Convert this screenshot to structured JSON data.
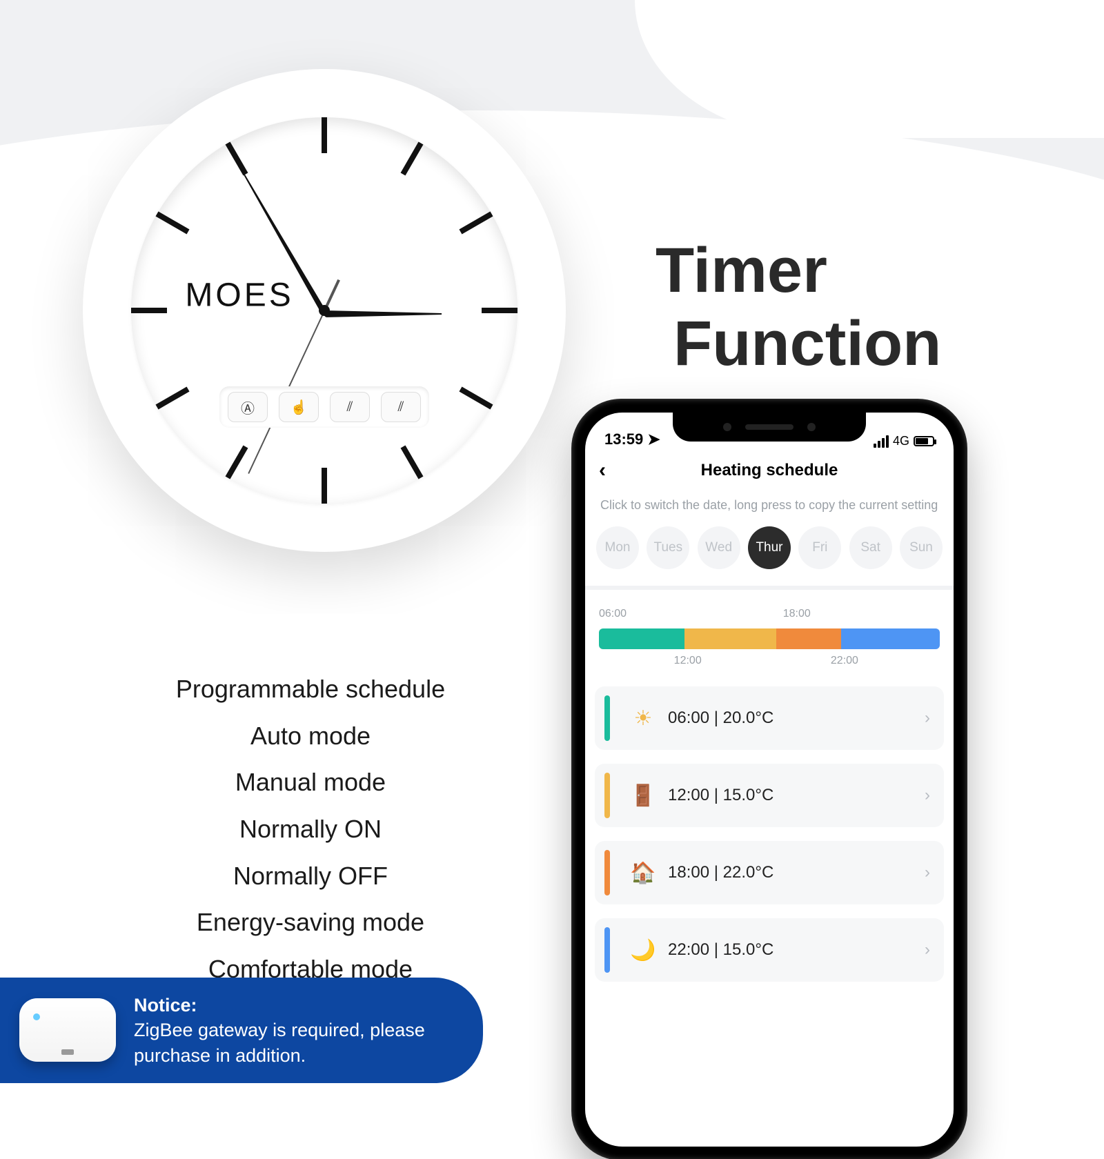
{
  "title_line1": "Timer",
  "title_line2": "Function",
  "clock_brand": "MOES",
  "features": [
    "Programmable schedule",
    "Auto mode",
    "Manual mode",
    "Normally ON",
    "Normally OFF",
    "Energy-saving mode",
    "Comfortable mode"
  ],
  "notice": {
    "heading": "Notice:",
    "body": "ZigBee gateway is required, please purchase in addition."
  },
  "phone": {
    "status_time": "13:59",
    "network": "4G",
    "screen_title": "Heating schedule",
    "hint": "Click to switch the date, long press to copy the current setting",
    "days": [
      "Mon",
      "Tues",
      "Wed",
      "Thur",
      "Fri",
      "Sat",
      "Sun"
    ],
    "active_day_index": 3,
    "timeline_top": [
      "06:00",
      "18:00"
    ],
    "timeline_bottom": [
      "12:00",
      "22:00"
    ],
    "rows": [
      {
        "color": "teal",
        "icon": "☀",
        "text": "06:00  |  20.0°C"
      },
      {
        "color": "amber",
        "icon": "🚪",
        "text": "12:00  |  15.0°C"
      },
      {
        "color": "orange",
        "icon": "🏠",
        "text": "18:00  |  22.0°C"
      },
      {
        "color": "blue",
        "icon": "🌙",
        "text": "22:00  |  15.0°C"
      }
    ]
  }
}
